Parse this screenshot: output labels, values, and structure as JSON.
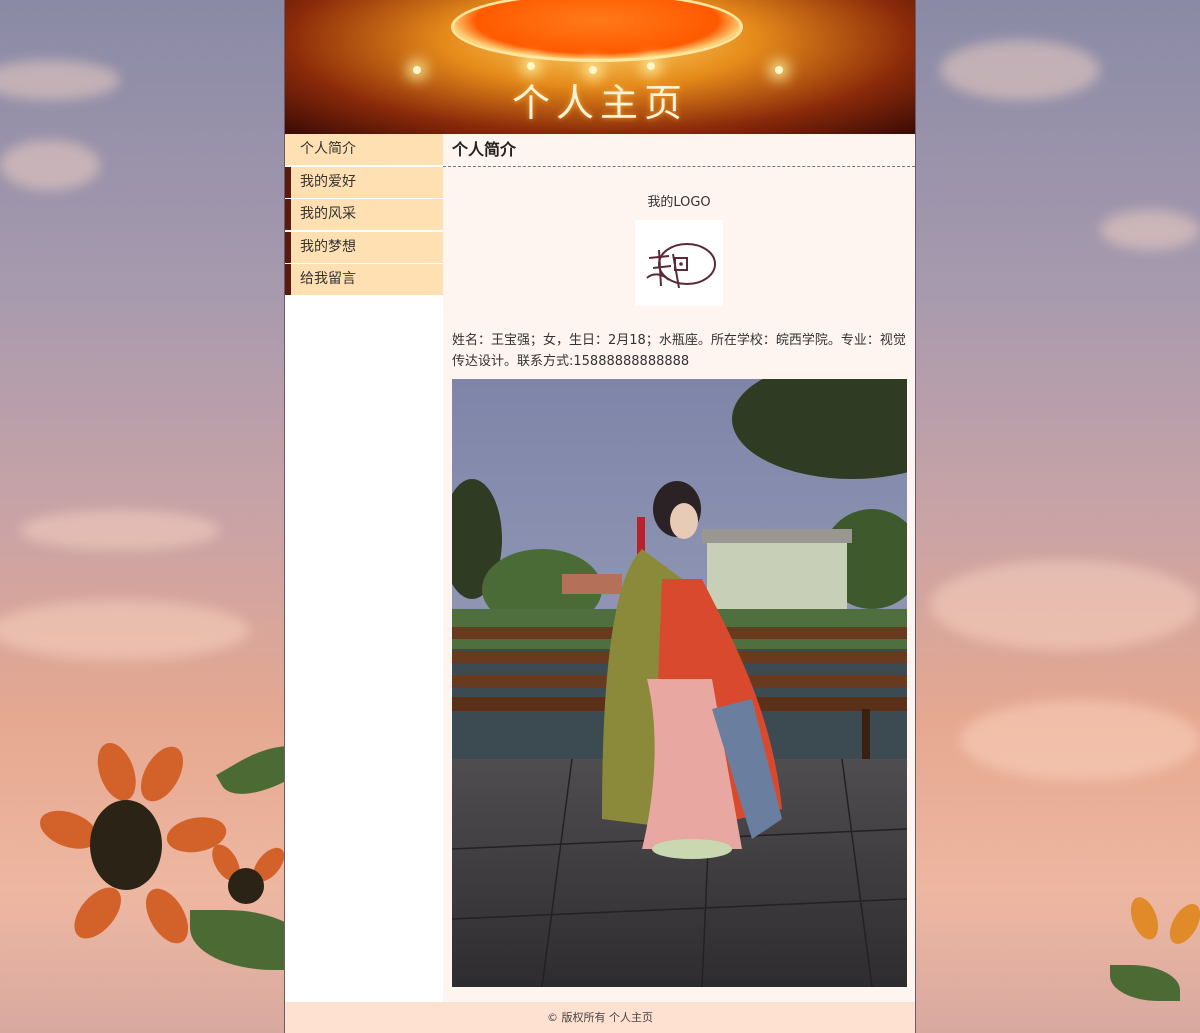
{
  "header": {
    "title": "个人主页"
  },
  "sidebar": {
    "items": [
      {
        "label": "个人简介"
      },
      {
        "label": "我的爱好"
      },
      {
        "label": "我的风采"
      },
      {
        "label": "我的梦想"
      },
      {
        "label": "给我留言"
      }
    ]
  },
  "main": {
    "heading": "个人简介",
    "logo_caption": "我的LOGO",
    "intro_text": "姓名：王宝强；女，生日：2月18；水瓶座。所在学校：皖西学院。专业：视觉传达设计。联系方式:15888888888888"
  },
  "footer": {
    "copyright": "© 版权所有 个人主页"
  },
  "colors": {
    "nav_bg": "#ffe0b2",
    "content_bg": "#fff5f0",
    "footer_bg": "#ffe1d1",
    "nav_accent": "#5a1a10"
  }
}
